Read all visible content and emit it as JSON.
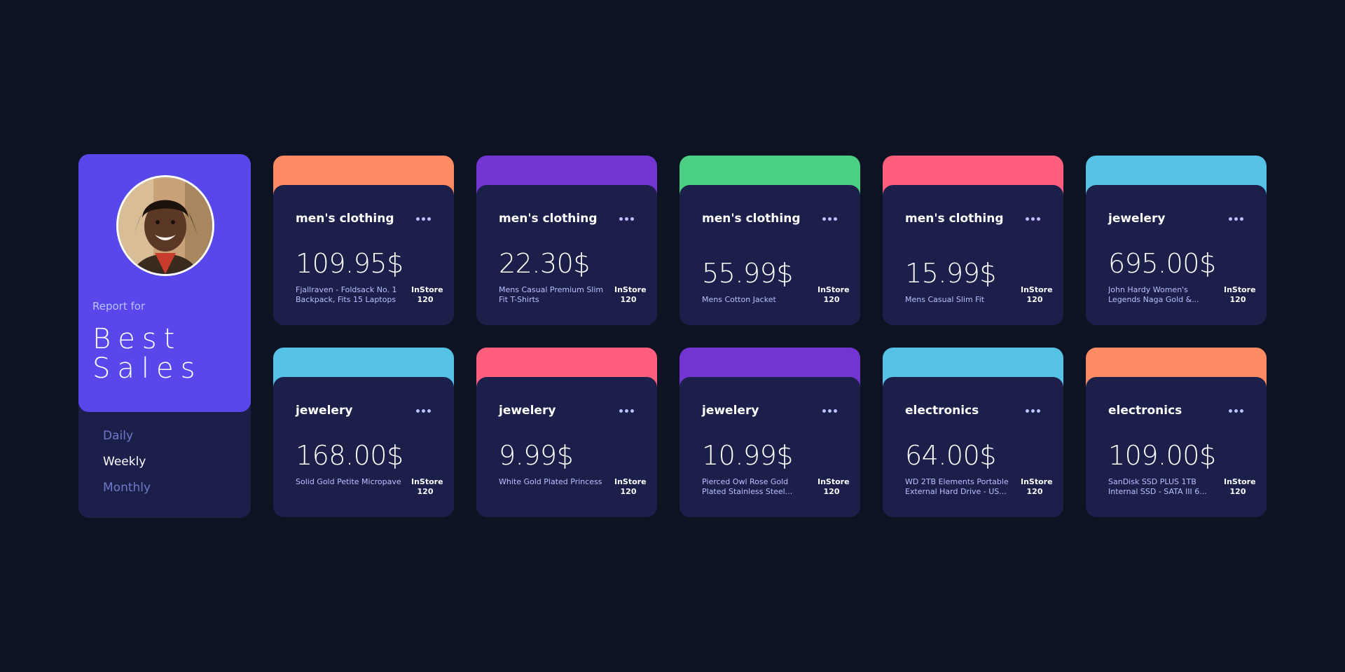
{
  "profile": {
    "report_for": "Report for",
    "title_line1": "Best",
    "title_line2": "Sales",
    "periods": [
      "Daily",
      "Weekly",
      "Monthly"
    ],
    "active_period": "Weekly"
  },
  "instore_label": "InStore",
  "cards": [
    {
      "category": "men's clothing",
      "price": "109.95$",
      "name": "Fjallraven - Foldsack No. 1 Backpack, Fits 15 Laptops",
      "instore": "120",
      "color": "#ff8b64"
    },
    {
      "category": "men's clothing",
      "price": "22.30$",
      "name": "Mens Casual Premium Slim Fit T-Shirts",
      "instore": "120",
      "color": "#7335d2"
    },
    {
      "category": "men's clothing",
      "price": "55.99$",
      "name": "Mens Cotton Jacket",
      "instore": "120",
      "color": "#4bcf82"
    },
    {
      "category": "men's clothing",
      "price": "15.99$",
      "name": "Mens Casual Slim Fit",
      "instore": "120",
      "color": "#ff5e7d"
    },
    {
      "category": "jewelery",
      "price": "695.00$",
      "name": "John Hardy Women's Legends Naga Gold &...",
      "instore": "120",
      "color": "#55c2e6"
    },
    {
      "category": "jewelery",
      "price": "168.00$",
      "name": "Solid Gold Petite Micropave",
      "instore": "120",
      "color": "#55c2e6"
    },
    {
      "category": "jewelery",
      "price": "9.99$",
      "name": "White Gold Plated Princess",
      "instore": "120",
      "color": "#ff5e7d"
    },
    {
      "category": "jewelery",
      "price": "10.99$",
      "name": "Pierced Owl Rose Gold Plated Stainless Steel...",
      "instore": "120",
      "color": "#7335d2"
    },
    {
      "category": "electronics",
      "price": "64.00$",
      "name": "WD 2TB Elements Portable External Hard Drive - US...",
      "instore": "120",
      "color": "#55c2e6"
    },
    {
      "category": "electronics",
      "price": "109.00$",
      "name": "SanDisk SSD PLUS 1TB Internal SSD - SATA III 6...",
      "instore": "120",
      "color": "#ff8b64"
    }
  ]
}
